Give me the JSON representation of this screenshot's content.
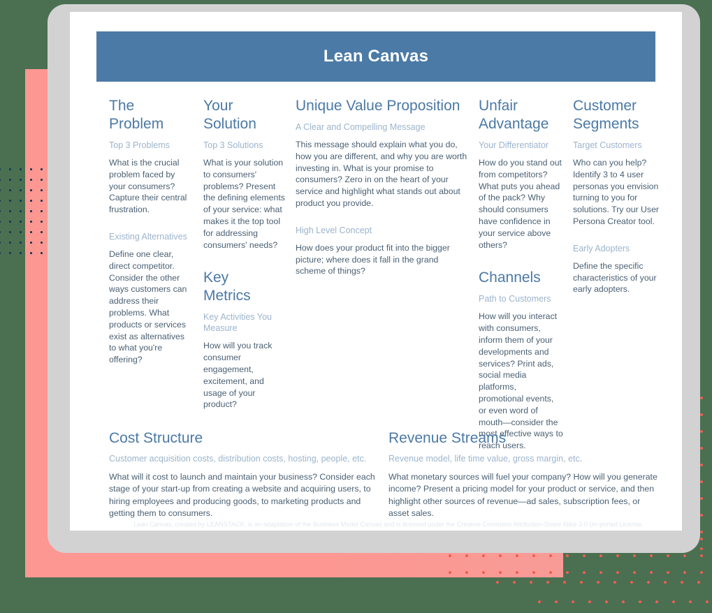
{
  "banner": {
    "title": "Lean Canvas"
  },
  "colors": {
    "background_green": "#4a7051",
    "panel_pink": "#fd9792",
    "banner_blue": "#4b7aa6",
    "heading_blue": "#4b79a6",
    "subheading_blue": "#9cb4cc",
    "body_text": "#4a6073",
    "dot_navy": "#123a52",
    "dot_red": "#ef5d52",
    "frame_gray": "#d2d2d2",
    "card_white": "#ffffff",
    "footer_text": "#e2e7ee"
  },
  "columns": [
    {
      "id": "problem",
      "blocks": [
        {
          "heading": "The\nProblem",
          "subheading": "Top 3 Problems",
          "body": "What is the crucial problem faced by your consumers? Capture their central frustration."
        },
        {
          "heading": null,
          "subheading": "Existing Alternatives",
          "body": "Define one clear, direct competitor. Consider the other ways customers can address their problems. What products or services exist as alternatives to what you're offering?"
        }
      ]
    },
    {
      "id": "solution",
      "blocks": [
        {
          "heading": "Your\nSolution",
          "subheading": "Top 3 Solutions",
          "body": "What is your solution to consumers' problems? Present the defining elements of your service: what makes it the top tool for addressing consumers' needs?"
        },
        {
          "heading": "Key\nMetrics",
          "subheading": "Key Activities You Measure",
          "body": "How will you track consumer engagement, excitement, and usage of your product?"
        }
      ]
    },
    {
      "id": "unique-value-proposition",
      "blocks": [
        {
          "heading": "Unique Value Proposition",
          "subheading": "A Clear and Compelling Message",
          "body": "This message should explain what you do, how you are different, and why you are worth investing in. What is your promise to consumers? Zero in on the heart of your service and highlight what stands out about product you provide."
        },
        {
          "heading": null,
          "subheading": "High Level Concept",
          "body": "How does your product fit into the bigger picture; where does it fall in the grand scheme of things?"
        }
      ]
    },
    {
      "id": "unfair-advantage",
      "blocks": [
        {
          "heading": "Unfair\nAdvantage",
          "subheading": "Your Differentiator",
          "body": "How do you stand out from competitors? What puts you ahead of the pack? Why should consumers have confidence in your service above others?"
        },
        {
          "heading": "Channels",
          "subheading": "Path to Customers",
          "body": "How will you interact with consumers, inform them of your developments and services? Print ads, social media platforms, promotional events, or even word of mouth—consider the most effective ways to reach users."
        }
      ]
    },
    {
      "id": "customer-segments",
      "blocks": [
        {
          "heading": "Customer\nSegments",
          "subheading": "Target Customers",
          "body": "Who can you help? Identify 3 to 4 user personas you envision turning to you for solutions. Try our User Persona Creator tool."
        },
        {
          "heading": null,
          "subheading": "Early Adopters",
          "body": "Define the specific characteristics of your early adopters."
        }
      ]
    }
  ],
  "bottom": [
    {
      "id": "cost-structure",
      "heading": "Cost Structure",
      "subheading": "Customer acquisition costs, distribution costs, hosting, people, etc.",
      "body": "What will it cost to launch and maintain your business? Consider each stage of your start-up from creating a website and acquiring users, to hiring employees and producing goods, to marketing products and getting them to consumers."
    },
    {
      "id": "revenue-streams",
      "heading": "Revenue Streams",
      "subheading": "Revenue model, life time value, gross margin, etc.",
      "body": "What monetary sources will fuel your company? How will you generate income? Present a pricing model for your product or service, and then highlight other sources of revenue—ad sales, subscription fees, or asset sales."
    }
  ],
  "footer": {
    "text": "Lean Canvas, created by LEANSTACK, is an adaptation of the Business Model Canvas and is licensed under the Creative Commons Attribution-Share Alike 3.0 Un-ported License."
  }
}
